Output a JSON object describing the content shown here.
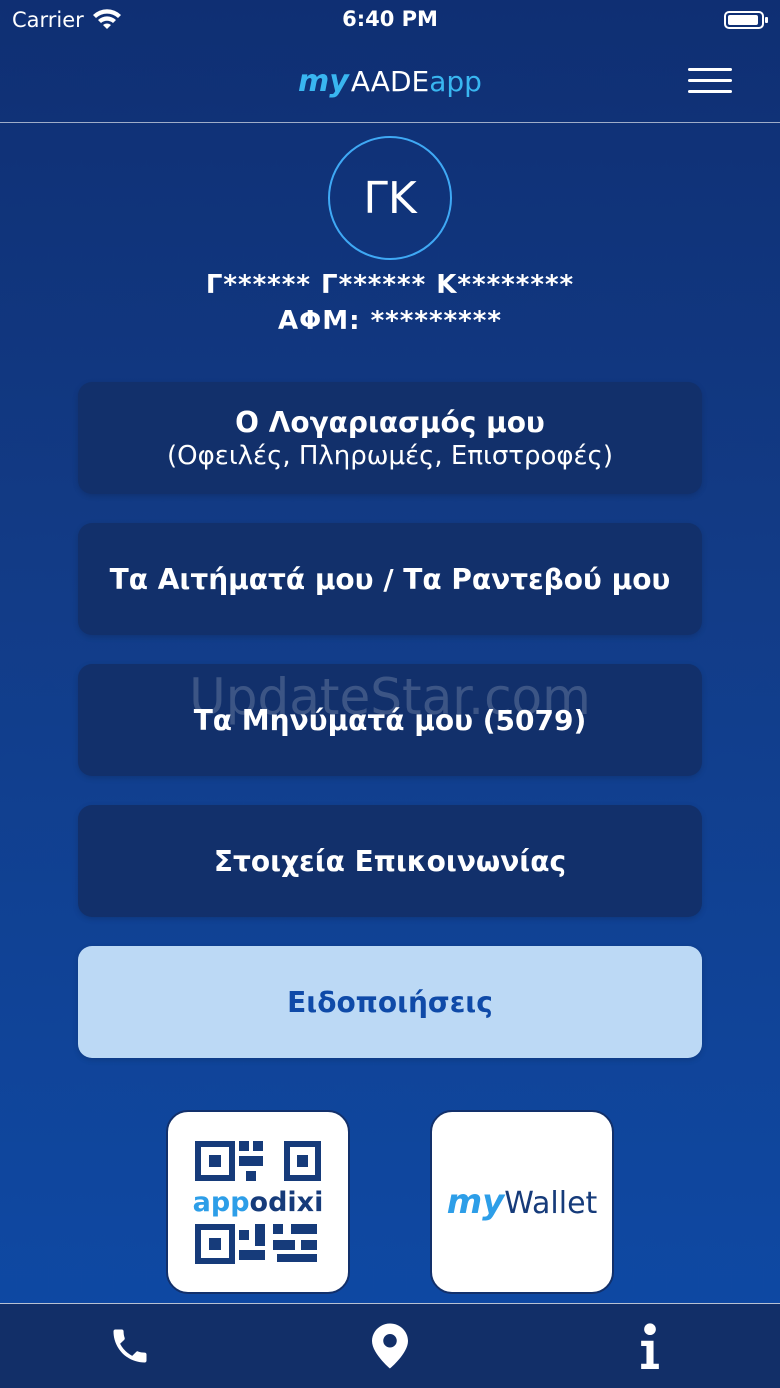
{
  "status_bar": {
    "carrier": "Carrier",
    "time": "6:40 PM"
  },
  "header": {
    "logo_my": "my",
    "logo_aade": "AADE",
    "logo_app": "app"
  },
  "profile": {
    "initials": "ΓΚ",
    "name": "Γ****** Γ****** Κ********",
    "afm": "ΑΦΜ: *********"
  },
  "menu": {
    "account_title": "Ο Λογαριασμός μου",
    "account_sub": "(Οφειλές, Πληρωμές, Επιστροφές)",
    "requests": "Τα Αιτήματά μου / Τα Ραντεβού μου",
    "messages": "Τα Μηνύματά μου (5079)",
    "contact": "Στοιχεία Επικοινωνίας",
    "notifications": "Ειδοποιήσεις"
  },
  "watermark": "UpdateStar.com",
  "tiles": {
    "appodixi_a": "app",
    "appodixi_b": "odixi",
    "wallet_my": "my",
    "wallet_word": "Wallet"
  },
  "tab_bar": {
    "icons": [
      "phone-icon",
      "location-pin-icon",
      "info-icon"
    ]
  },
  "colors": {
    "background_top": "#0f2f73",
    "background_bottom": "#0e4aa6",
    "card": "#12306b",
    "card_light": "#bcd9f5",
    "accent": "#39b6f0",
    "dark_brand": "#163b7a"
  }
}
